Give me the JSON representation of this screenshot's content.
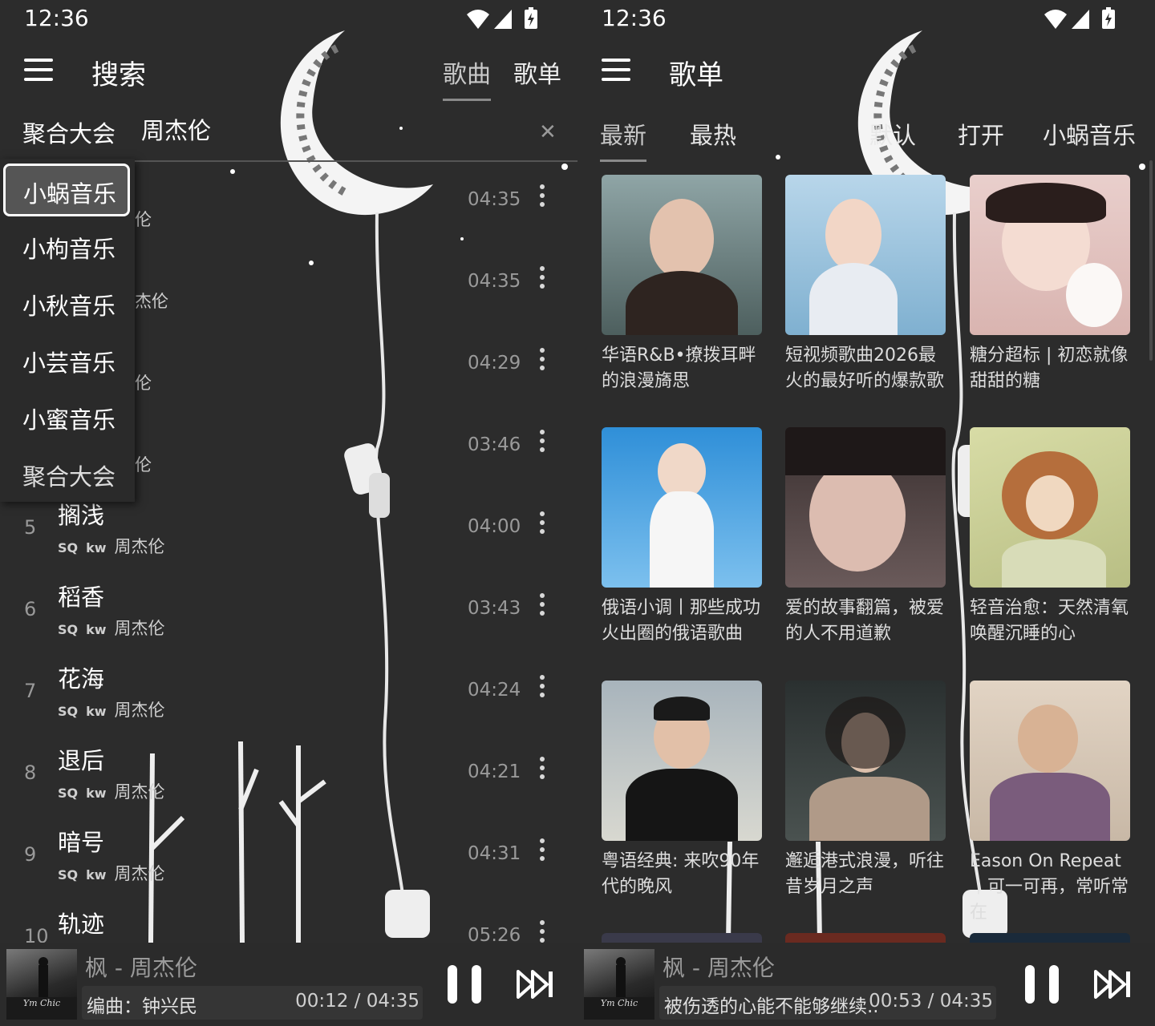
{
  "status": {
    "time_left": "12:36",
    "time_right": "12:36"
  },
  "left": {
    "title": "搜索",
    "tabs": [
      {
        "label": "歌曲",
        "active": true
      },
      {
        "label": "歌单",
        "active": false
      }
    ],
    "search": {
      "source": "聚合大会",
      "query": "周杰伦"
    },
    "dropdown": [
      "小蜗音乐",
      "小枸音乐",
      "小秋音乐",
      "小芸音乐",
      "小蜜音乐",
      "聚合大会"
    ],
    "dropdown_selected": "小蜗音乐",
    "hidden_artist_fragments": [
      "伦",
      "杰伦",
      "伦",
      "伦"
    ],
    "songs": [
      {
        "index": "",
        "title": "",
        "quality": "",
        "source": "",
        "artist": "",
        "duration": "04:35"
      },
      {
        "index": "",
        "title": "",
        "quality": "",
        "source": "",
        "artist": "",
        "duration": "04:35"
      },
      {
        "index": "",
        "title": "",
        "quality": "",
        "source": "",
        "artist": "",
        "duration": "04:29"
      },
      {
        "index": "",
        "title": "",
        "quality": "",
        "source": "",
        "artist": "",
        "duration": "03:46"
      },
      {
        "index": "5",
        "title": "搁浅",
        "quality": "SQ",
        "source": "kw",
        "artist": "周杰伦",
        "duration": "04:00"
      },
      {
        "index": "6",
        "title": "稻香",
        "quality": "SQ",
        "source": "kw",
        "artist": "周杰伦",
        "duration": "03:43"
      },
      {
        "index": "7",
        "title": "花海",
        "quality": "SQ",
        "source": "kw",
        "artist": "周杰伦",
        "duration": "04:24"
      },
      {
        "index": "8",
        "title": "退后",
        "quality": "SQ",
        "source": "kw",
        "artist": "周杰伦",
        "duration": "04:21"
      },
      {
        "index": "9",
        "title": "暗号",
        "quality": "SQ",
        "source": "kw",
        "artist": "周杰伦",
        "duration": "04:31"
      },
      {
        "index": "10",
        "title": "轨迹",
        "quality": "",
        "source": "",
        "artist": "",
        "duration": "05:26"
      }
    ],
    "player": {
      "now_playing": "枫 - 周杰伦",
      "lyric": "编曲：钟兴民",
      "time": "00:12 / 04:35",
      "cover_text": "Ym Chic"
    }
  },
  "right": {
    "title": "歌单",
    "tabs": [
      {
        "label": "最新",
        "active": true
      },
      {
        "label": "最热",
        "active": false
      },
      {
        "label": "默认",
        "active": false
      },
      {
        "label": "打开",
        "active": false
      },
      {
        "label": "小蜗音乐",
        "active": false
      }
    ],
    "playlists": [
      {
        "caption": "华语R&B•撩拨耳畔的浪漫旖思",
        "bg": "#6f8a88",
        "accent": "#3a2a22"
      },
      {
        "caption": "短视频歌曲2026最火的最好听的爆款歌",
        "bg": "#9fc4de",
        "accent": "#e8c8b8"
      },
      {
        "caption": "糖分超标 | 初恋就像甜甜的糖",
        "bg": "#e8c8c4",
        "accent": "#2a1e1c"
      },
      {
        "caption": "俄语小调丨那些成功火出圈的俄语歌曲",
        "bg": "#4a9fd8",
        "accent": "#f0f0f0"
      },
      {
        "caption": "爱的故事翻篇，被爱的人不用道歉",
        "bg": "#3a3434",
        "accent": "#d8b8a8"
      },
      {
        "caption": "轻音治愈：天然清氧唤醒沉睡的心",
        "bg": "#c8cc98",
        "accent": "#c0804a"
      },
      {
        "caption": "粤语经典: 来吹90年代的晚风",
        "bg": "#b8c0c4",
        "accent": "#1a1a1a"
      },
      {
        "caption": "邂逅港式浪漫，听往昔岁月之声",
        "bg": "#3a4040",
        "accent": "#c8b0a0"
      },
      {
        "caption": "Eason On Repeat｜可一可再，常听常在",
        "bg": "#d8c8b8",
        "accent": "#7a5a7a"
      }
    ],
    "player": {
      "now_playing": "枫 - 周杰伦",
      "lyric": "被伤透的心能不能够继续...",
      "time": "00:53 / 04:35",
      "cover_text": "Ym Chic"
    }
  }
}
